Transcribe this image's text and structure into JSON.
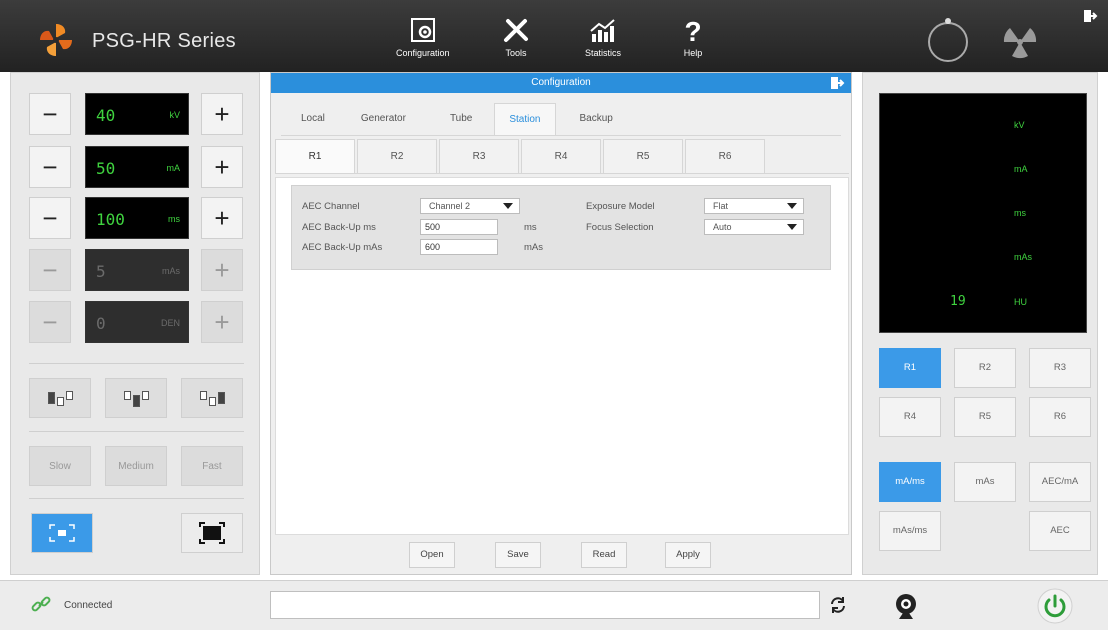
{
  "app": {
    "title": "PSG-HR Series"
  },
  "topnav": [
    {
      "label": "Configuration",
      "icon": "gear-square-icon"
    },
    {
      "label": "Tools",
      "icon": "tools-icon"
    },
    {
      "label": "Statistics",
      "icon": "chart-icon"
    },
    {
      "label": "Help",
      "icon": "help-icon"
    }
  ],
  "left": {
    "params": [
      {
        "value": "40",
        "unit": "kV",
        "enabled": true
      },
      {
        "value": "50",
        "unit": "mA",
        "enabled": true
      },
      {
        "value": "100",
        "unit": "ms",
        "enabled": true
      },
      {
        "value": "5",
        "unit": "mAs",
        "enabled": false
      },
      {
        "value": "0",
        "unit": "DEN",
        "enabled": false
      }
    ],
    "minus": "−",
    "plus": "+",
    "speed": [
      "Slow",
      "Medium",
      "Fast"
    ]
  },
  "config": {
    "title": "Configuration",
    "tabs": [
      "Local",
      "Generator",
      "Tube",
      "Station",
      "Backup"
    ],
    "active_tab": "Station",
    "subtabs": [
      "R1",
      "R2",
      "R3",
      "R4",
      "R5",
      "R6"
    ],
    "active_subtab": "R1",
    "fields": {
      "aec_channel_label": "AEC Channel",
      "aec_channel_value": "Channel 2",
      "backup_ms_label": "AEC Back-Up ms",
      "backup_ms_value": "500",
      "backup_ms_unit": "ms",
      "backup_mas_label": "AEC Back-Up mAs",
      "backup_mas_value": "600",
      "backup_mas_unit": "mAs",
      "exposure_model_label": "Exposure Model",
      "exposure_model_value": "Flat",
      "focus_selection_label": "Focus Selection",
      "focus_selection_value": "Auto"
    },
    "footer": [
      "Open",
      "Save",
      "Read",
      "Apply"
    ]
  },
  "right": {
    "display_units": [
      "kV",
      "mA",
      "ms",
      "mAs",
      "HU"
    ],
    "hu_value": "19",
    "room_buttons": [
      "R1",
      "R2",
      "R3",
      "R4",
      "R5",
      "R6"
    ],
    "active_room": "R1",
    "mode_buttons": [
      "mA/ms",
      "mAs",
      "AEC/mA",
      "mAs/ms",
      "AEC"
    ],
    "active_mode": "mA/ms"
  },
  "status": {
    "connection": "Connected"
  },
  "colors": {
    "accent": "#3b9ae8",
    "display_green": "#3fd33f",
    "topbar": "#2b2b2b"
  }
}
